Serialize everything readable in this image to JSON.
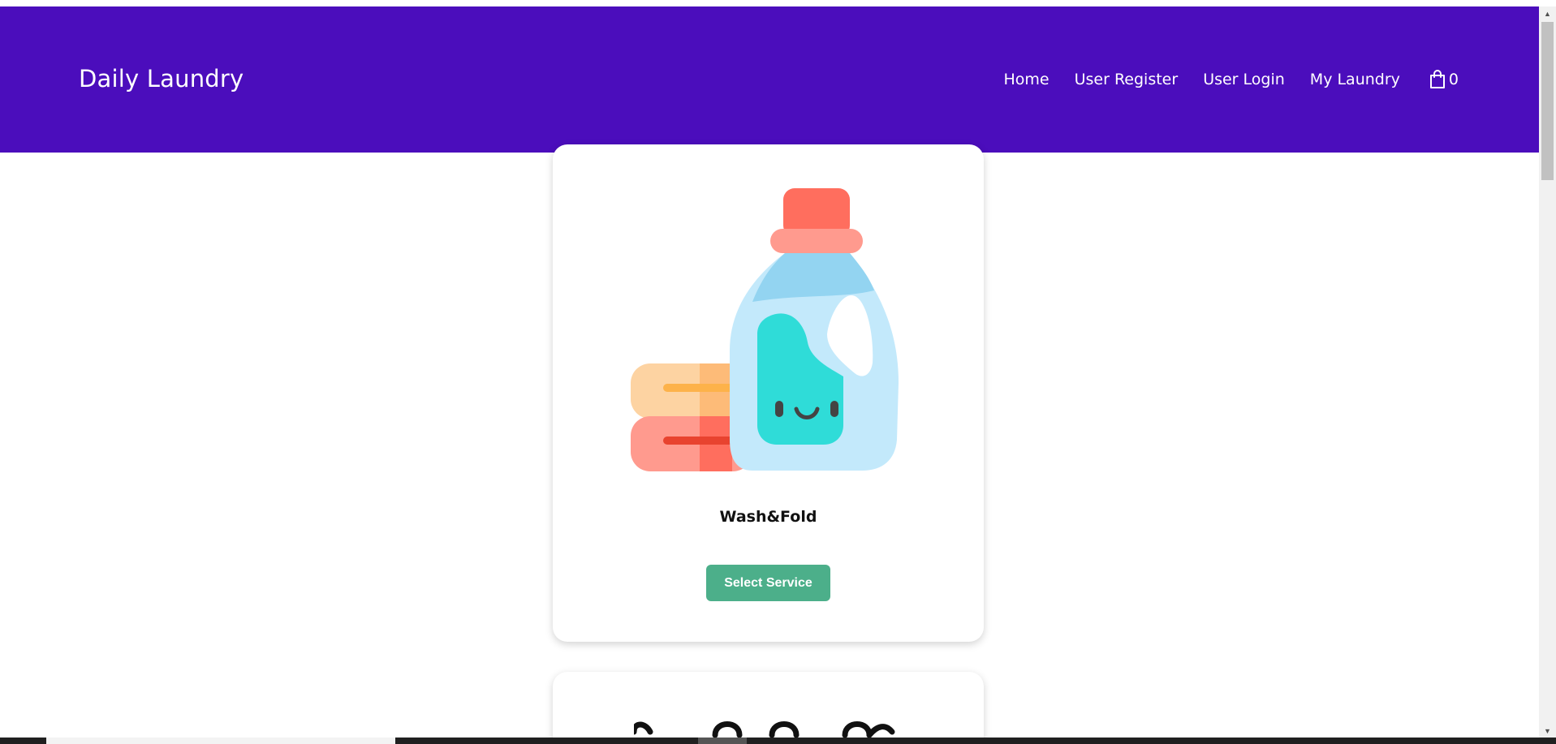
{
  "header": {
    "brand": "Daily Laundry",
    "nav": [
      {
        "label": "Home"
      },
      {
        "label": "User Register"
      },
      {
        "label": "User Login"
      },
      {
        "label": "My Laundry"
      }
    ],
    "cart": {
      "icon": "shopping-bag-icon",
      "count": "0"
    }
  },
  "services": [
    {
      "title": "Wash&Fold",
      "button_label": "Select Service",
      "image": "detergent-bottle-and-folded-towels"
    }
  ],
  "colors": {
    "navbar": "#4b0dbc",
    "button": "#4caf8a",
    "text_dark": "#111111"
  }
}
